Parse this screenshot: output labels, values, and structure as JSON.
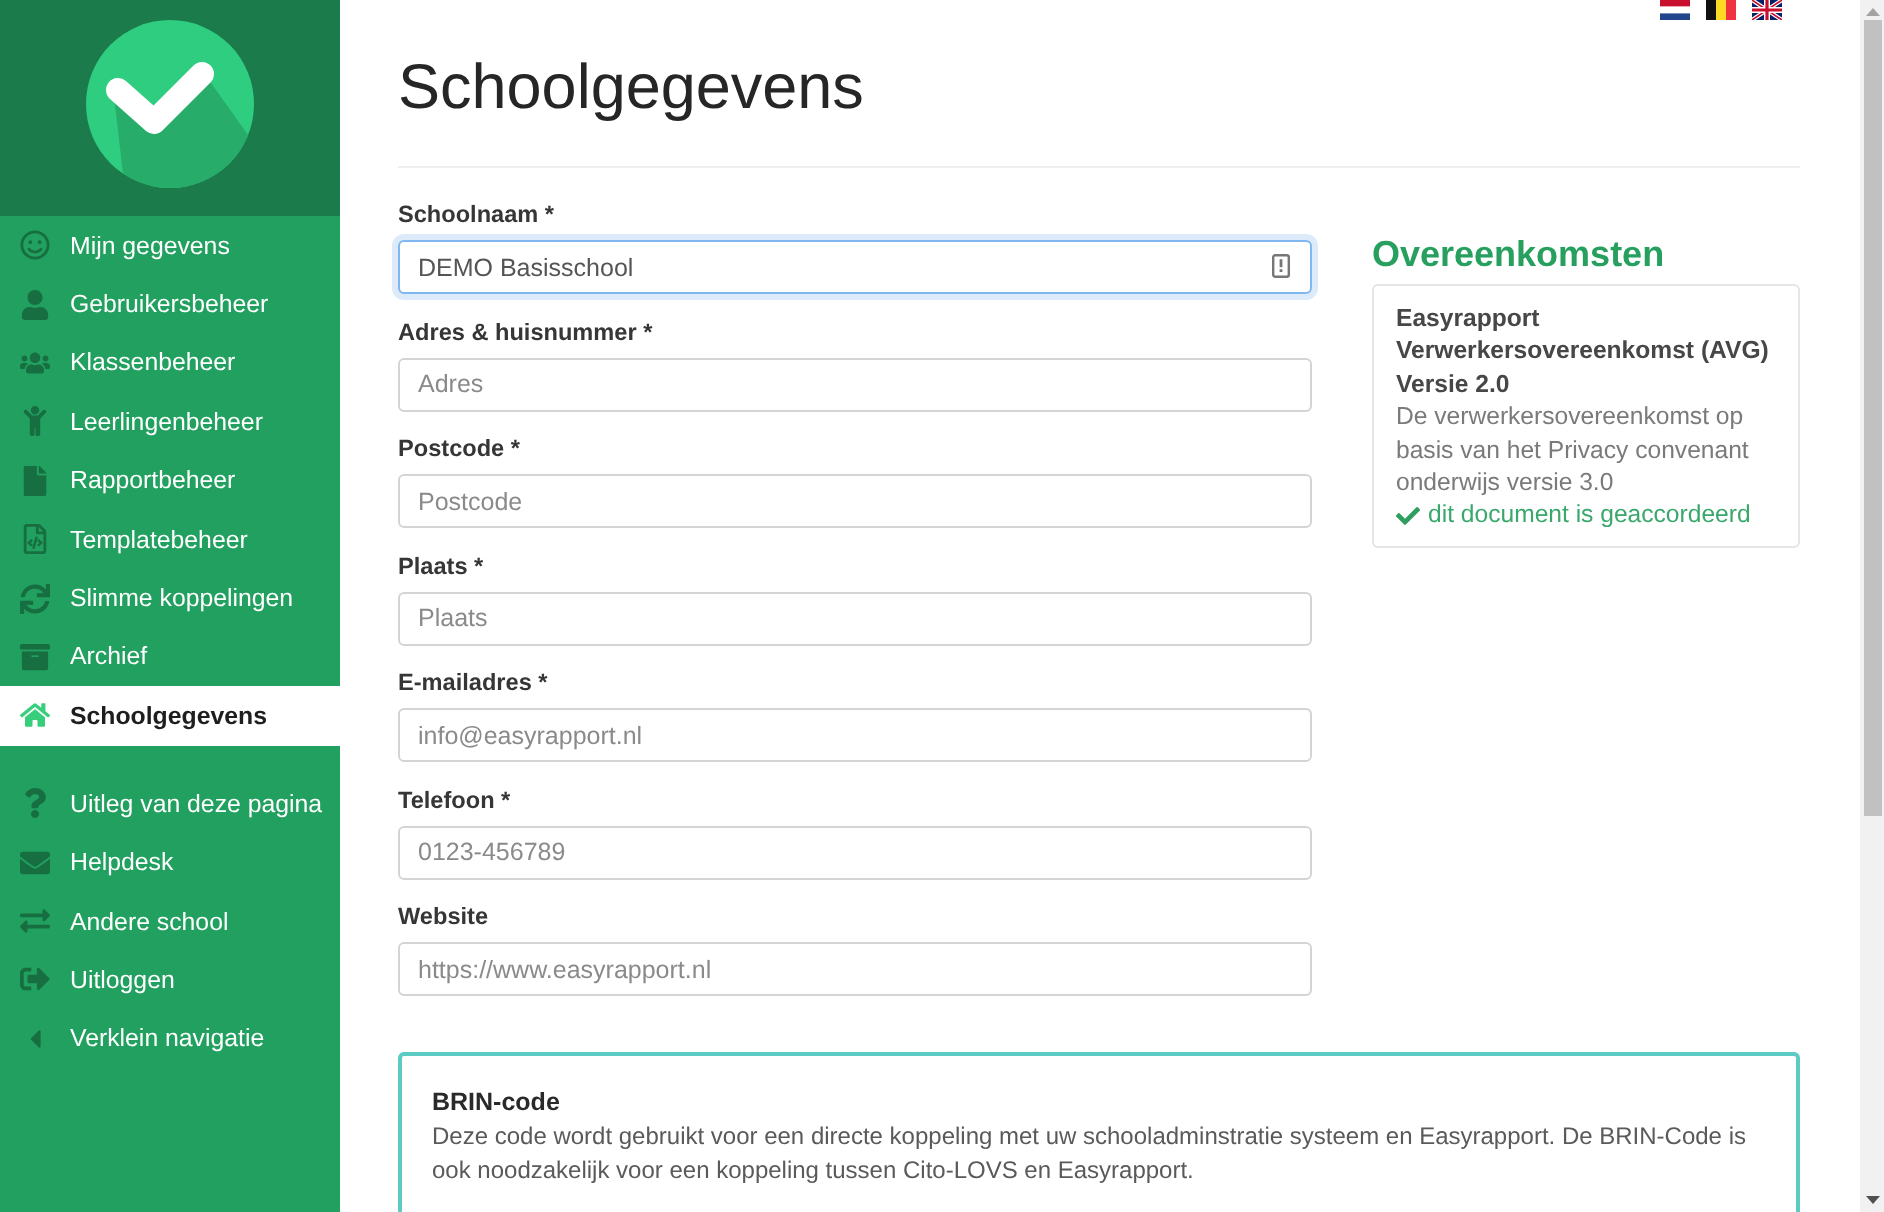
{
  "sidebar": {
    "main_items": [
      {
        "label": "Mijn gegevens",
        "selected": false
      },
      {
        "label": "Gebruikersbeheer",
        "selected": false
      },
      {
        "label": "Klassenbeheer",
        "selected": false
      },
      {
        "label": "Leerlingenbeheer",
        "selected": false
      },
      {
        "label": "Rapportbeheer",
        "selected": false
      },
      {
        "label": "Templatebeheer",
        "selected": false
      },
      {
        "label": "Slimme koppelingen",
        "selected": false
      },
      {
        "label": "Archief",
        "selected": false
      },
      {
        "label": "Schoolgegevens",
        "selected": true
      }
    ],
    "secondary_items": [
      {
        "label": "Uitleg van deze pagina",
        "selected": false
      },
      {
        "label": "Helpdesk",
        "selected": false
      },
      {
        "label": "Andere school",
        "selected": false
      },
      {
        "label": "Uitloggen",
        "selected": false
      },
      {
        "label": "Verklein navigatie",
        "selected": false
      }
    ]
  },
  "page": {
    "title": "Schoolgegevens"
  },
  "form": {
    "fields": [
      {
        "label": "Schoolnaam *",
        "value": "DEMO Basisschool",
        "focused": true,
        "autofill_icon": true
      },
      {
        "label": "Adres & huisnummer *",
        "placeholder": "Adres",
        "focused": false,
        "autofill_icon": false
      },
      {
        "label": "Postcode *",
        "placeholder": "Postcode",
        "focused": false,
        "autofill_icon": false
      },
      {
        "label": "Plaats *",
        "placeholder": "Plaats",
        "focused": false,
        "autofill_icon": false
      },
      {
        "label": "E-mailadres *",
        "placeholder": "info@easyrapport.nl",
        "focused": false,
        "autofill_icon": false
      },
      {
        "label": "Telefoon *",
        "placeholder": "0123-456789",
        "focused": false,
        "autofill_icon": false
      },
      {
        "label": "Website",
        "placeholder": "https://www.easyrapport.nl",
        "focused": false,
        "autofill_icon": false
      }
    ]
  },
  "agreements": {
    "heading": "Overeenkomsten",
    "cards": [
      {
        "title": "Easyrapport Verwerkersovereenkomst (AVG) Versie 2.0",
        "description": "De verwerkersovereenkomst op basis van het Privacy convenant onderwijs versie 3.0",
        "status": "dit document is geaccordeerd",
        "accepted": true
      }
    ]
  },
  "brin_panel": {
    "title": "BRIN-code",
    "text": "Deze code wordt gebruikt voor een directe koppeling met uw schooladminstratie systeem en Easyrapport. De BRIN-Code is ook noodzakelijk voor een koppeling tussen Cito-LOVS en Easyrapport."
  }
}
